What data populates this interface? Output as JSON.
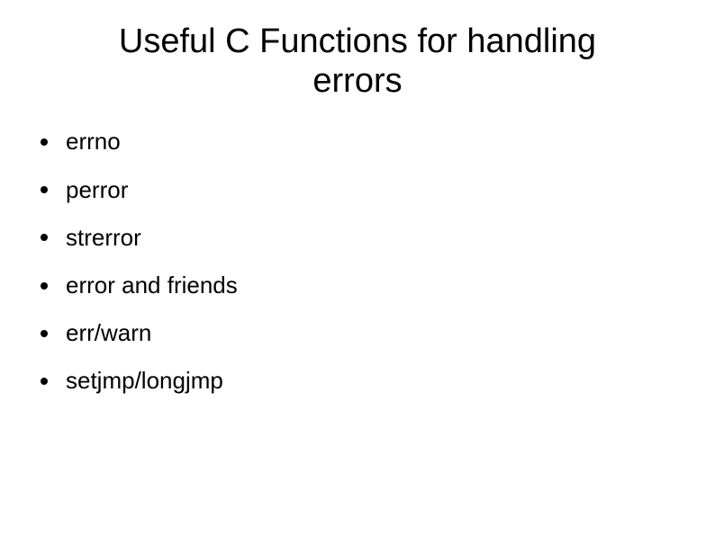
{
  "title": "Useful C Functions for handling errors",
  "bullets": [
    "errno",
    "perror",
    "strerror",
    "error and friends",
    "err/warn",
    "setjmp/longjmp"
  ]
}
